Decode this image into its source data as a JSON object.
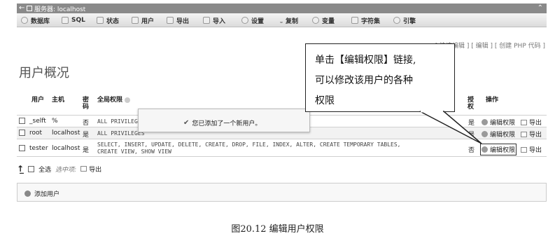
{
  "titlebar": {
    "back_icon": "←",
    "title": "服务器: localhost",
    "collapse_icon": "⌃"
  },
  "tabs": [
    {
      "label": "数据库",
      "icon": "database-icon"
    },
    {
      "label": "SQL",
      "icon": "sql-icon"
    },
    {
      "label": "状态",
      "icon": "status-icon"
    },
    {
      "label": "用户",
      "icon": "users-icon"
    },
    {
      "label": "导出",
      "icon": "export-icon"
    },
    {
      "label": "导入",
      "icon": "import-icon"
    },
    {
      "label": "设置",
      "icon": "settings-icon"
    },
    {
      "label": "复制",
      "icon": "replication-icon"
    },
    {
      "label": "变量",
      "icon": "variables-icon"
    },
    {
      "label": "字符集",
      "icon": "charset-icon"
    },
    {
      "label": "引擎",
      "icon": "engines-icon"
    }
  ],
  "links": {
    "text": "[ 快速编辑 ] [ 编辑 ] [ 创建 PHP 代码 ]"
  },
  "page_title": "用户概况",
  "table": {
    "headers": {
      "user": "用户",
      "host": "主机",
      "password": "密码",
      "global_privileges": "全局权限",
      "grant": "授权",
      "action": "操作"
    },
    "rows": [
      {
        "user": "_selft",
        "host": "%",
        "password": "否",
        "privileges": "ALL PRIVILEGES",
        "grant": "是",
        "edit": "编辑权限",
        "export": "导出"
      },
      {
        "user": "root",
        "host": "localhost",
        "password": "是",
        "privileges": "ALL PRIVILEGES",
        "grant": "是",
        "edit": "编辑权限",
        "export": "导出"
      },
      {
        "user": "tester",
        "host": "localhost",
        "password": "是",
        "privileges_line1": "SELECT, INSERT, UPDATE, DELETE, CREATE, DROP, FILE, INDEX, ALTER, CREATE TEMPORARY TABLES,",
        "privileges_line2": "CREATE VIEW, SHOW VIEW",
        "grant": "否",
        "edit": "编辑权限",
        "export": "导出"
      }
    ]
  },
  "footer": {
    "check_all": "全选",
    "with_selected": "选中项:",
    "export": "导出"
  },
  "add_user": {
    "label": "添加用户"
  },
  "notice": {
    "message": "您已添加了一个新用户。"
  },
  "callout": {
    "line1": "单击【编辑权限】链接,",
    "line2": "可以修改该用户的各种",
    "line3": "权限"
  },
  "caption": "图20.12   编辑用户权限"
}
